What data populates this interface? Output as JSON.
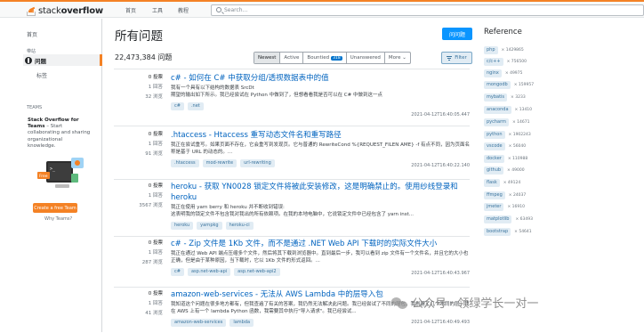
{
  "topbar": {
    "logo_plain": "stack",
    "logo_bold": "overflow",
    "nav": [
      "首页",
      "工具",
      "教程"
    ],
    "search_placeholder": "Search..."
  },
  "leftnav": {
    "home": "首页",
    "public": "带站",
    "questions": "问题",
    "tags": "标签",
    "teams_header": "TEAMS",
    "teams_title": "Stack Overflow for Teams",
    "teams_text": " – Start collaborating and sharing organizational knowledge.",
    "teams_button": "Create a free Team",
    "teams_why": "Why Teams?",
    "art_free": "Free"
  },
  "main": {
    "title": "所有问题",
    "ask_button": "问问题",
    "count": "22,473,384 问题",
    "filters": [
      {
        "label": "Newest",
        "active": true
      },
      {
        "label": "Active",
        "active": false
      },
      {
        "label": "Bountied",
        "badge": "318",
        "active": false
      },
      {
        "label": "Unanswered",
        "active": false
      },
      {
        "label": "More ⌄",
        "active": false
      }
    ],
    "filter_button": "Filter",
    "questions": [
      {
        "votes": "0 投票",
        "answers": "1 回答",
        "views": "32 浏览",
        "title": "c# - 如何在 C# 中获取分组/透视数据表中的值",
        "excerpt": "我有一个具有以下结构的数据表 SrcDt\n期望的输出如下所示。我已经尝试在 Python 中做到了，但想看看我是否可以在 C# 中做到这一点",
        "tags": [
          "c#",
          ".net"
        ],
        "time": "2021-04-12T16:40:05.447"
      },
      {
        "votes": "0 投票",
        "answers": "1 回答",
        "views": "91 浏览",
        "title": ".htaccess - Htaccess 重写动态文件名和重写路径",
        "excerpt": "我正在尝试重写。如果页面不存在，它会重写到发现页。它与普通的 RewriteCond %{REQUEST_FILEN AME} -f 有点不同，因为页面名称是基于 URL 的动态的。...",
        "tags": [
          ".htaccess",
          "mod-rewrite",
          "url-rewriting"
        ],
        "time": "2021-04-12T16:40:22.140"
      },
      {
        "votes": "0 投票",
        "answers": "1 回答",
        "views": "3567 浏览",
        "title": "heroku - 获取 YN0028 锁定文件将被此安装修改，这是明确禁止的。使用纱线登录和heroku",
        "excerpt": "我正在使用 yarn berry 和 heroku 并不断收到错误:\n这表明我的锁定文件不包含我对我出的所有依赖项。在我的本地电脑中，它说锁定文件中已经包含了 yarn inst...",
        "tags": [
          "heroku",
          "yarnpkg",
          "heroku-ci"
        ],
        "time": "2021-04-12T16:40:23.473"
      },
      {
        "votes": "0 投票",
        "answers": "1 回答",
        "views": "287 浏览",
        "title": "c# - Zip 文件是 1Kb 文件，而不是通过 .NET Web API 下载时的实际文件大小",
        "excerpt": "我正在通过 Web API 端点压缩多个文件，然后将其下载到浏览器中。直到最后一步，我可以看到 zip 文件有一个文件名，并且它的大小也正确，但是由于某种原因，当下载时，它以 1Kb 文件的形式返回。...",
        "tags": [
          "c#",
          "asp.net-web-api",
          "asp.net-web-api2"
        ],
        "time": "2021-04-12T16:40:43.967"
      },
      {
        "votes": "0 投票",
        "answers": "1 回答",
        "views": "41 浏览",
        "title": "amazon-web-services - 无法从 AWS Lambda 中的层导入包",
        "excerpt": "我知道这个问题在很多地方都有，但我查遍了有关的答案，我仍然无法解决此问题。我已经尝试了不同的层包，我创建了几个不同的层。我在 AWS 上有一个 lambda Python 函数，我需要其中执行\"导入请求\"。我已经尝试...",
        "tags": [
          "amazon-web-services",
          "lambda"
        ],
        "time": "2021-04-12T16:40:49.493"
      }
    ]
  },
  "reference": {
    "title": "Reference",
    "tags": [
      {
        "name": "php",
        "count": "× 1429865"
      },
      {
        "name": "c/c++",
        "count": "× 756500"
      },
      {
        "name": "nginx",
        "count": "× 49975"
      },
      {
        "name": "mongodb",
        "count": "× 159957"
      },
      {
        "name": "mybatis",
        "count": "× 3233"
      },
      {
        "name": "anaconda",
        "count": "× 13410"
      },
      {
        "name": "pycharm",
        "count": "× 14671"
      },
      {
        "name": "python",
        "count": "× 1902243"
      },
      {
        "name": "vscode",
        "count": "× 56040"
      },
      {
        "name": "docker",
        "count": "× 110988"
      },
      {
        "name": "github",
        "count": "× 49000"
      },
      {
        "name": "flask",
        "count": "× 49124"
      },
      {
        "name": "ffmpeg",
        "count": "× 24037"
      },
      {
        "name": "jmeter",
        "count": "× 16910"
      },
      {
        "name": "matplotlib",
        "count": "× 63493"
      },
      {
        "name": "bootstrap",
        "count": "× 54641"
      }
    ]
  },
  "watermark": "公众号 · 领绿学长一对一"
}
